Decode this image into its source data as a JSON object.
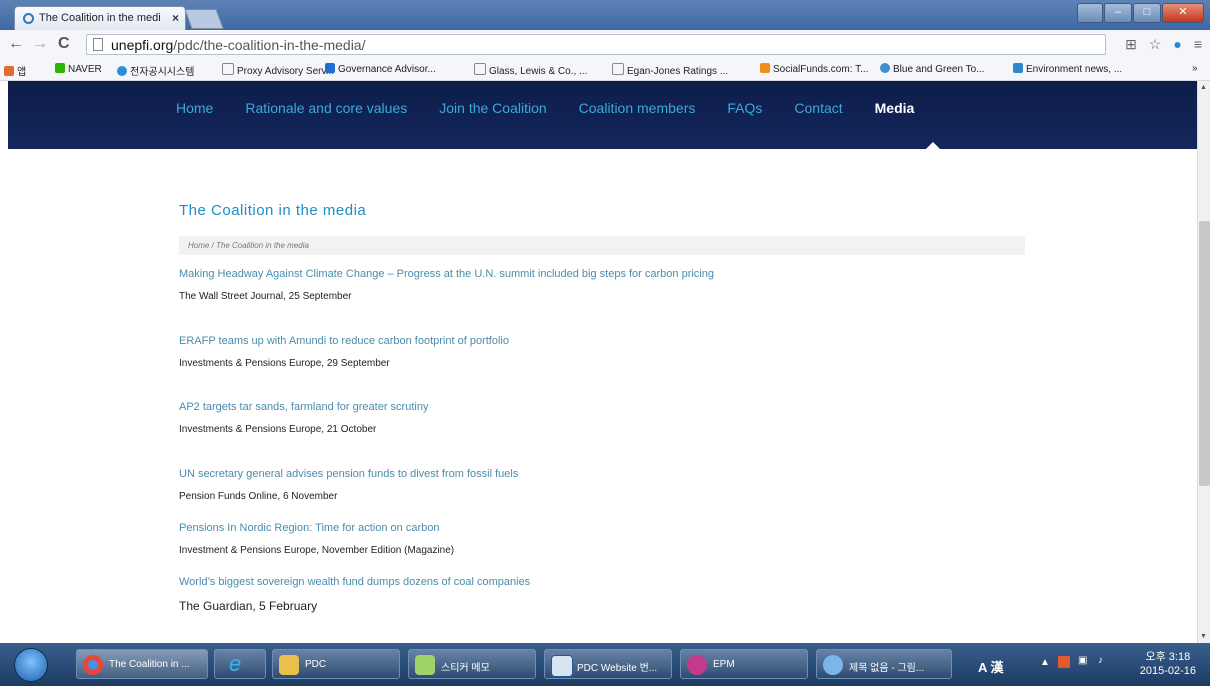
{
  "browser": {
    "tab_title": "The Coalition in the medi",
    "tab_close": "×",
    "url_host": "unepfi.org",
    "url_path": "/pdc/the-coalition-in-the-media/",
    "bookmarks": [
      "앱",
      "NAVER",
      "전자공시시스템",
      "Proxy Advisory Serv...",
      "Governance Advisor...",
      "Glass, Lewis & Co., ...",
      "Egan-Jones Ratings ...",
      "SocialFunds.com: T...",
      "Blue and Green To...",
      "Environment news, ...",
      "»"
    ]
  },
  "site_nav": {
    "items": [
      "Home",
      "Rationale and core values",
      "Join the Coalition",
      "Coalition members",
      "FAQs",
      "Contact",
      "Media"
    ],
    "active": "Media"
  },
  "page": {
    "title": "The Coalition in the media",
    "breadcrumb": "Home  /  The Coalition in the media",
    "articles": [
      {
        "title": "Making Headway Against Climate Change – Progress at the U.N. summit included big steps for carbon pricing",
        "source": "The Wall Street Journal, 25 September"
      },
      {
        "title": "ERAFP teams up with Amundi to reduce carbon footprint of portfolio",
        "source": "Investments & Pensions Europe, 29 September"
      },
      {
        "title": "AP2 targets tar sands, farmland for greater scrutiny",
        "source": "Investments & Pensions Europe, 21 October"
      },
      {
        "title": "UN secretary general advises pension funds to divest from fossil fuels",
        "source": "Pension Funds Online, 6 November"
      },
      {
        "title": "Pensions In Nordic Region: Time for action on carbon",
        "source": "Investment & Pensions Europe, November Edition (Magazine)"
      },
      {
        "title": "World’s biggest sovereign wealth fund dumps dozens of coal companies",
        "source": "The Guardian, 5 February"
      }
    ]
  },
  "taskbar": {
    "items": [
      "The Coalition in ...",
      "",
      "PDC",
      "스티커 메모",
      "PDC Website 번...",
      "EPM",
      "제목 없음 - 그림..."
    ],
    "tray_lang": "A 漢",
    "clock_time": "오후 3:18",
    "clock_date": "2015-02-16"
  },
  "colors": {
    "nav_bg": "#13275c",
    "link": "#4b8cac",
    "heading": "#1a8fc7",
    "nav_text": "#3aa9d9"
  }
}
